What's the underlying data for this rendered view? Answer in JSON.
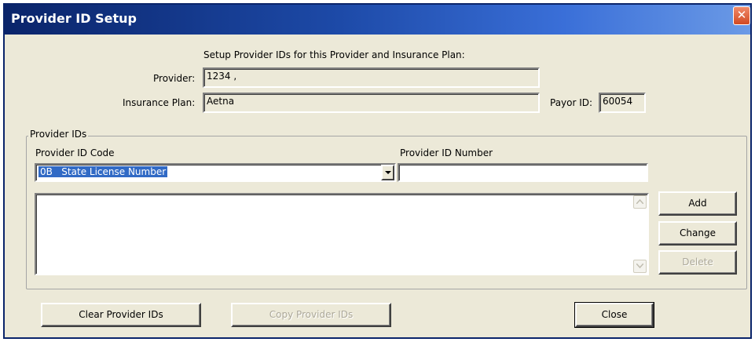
{
  "window": {
    "title": "Provider ID Setup"
  },
  "header": {
    "instruction": "Setup Provider IDs for this Provider and Insurance Plan:"
  },
  "provider": {
    "label": "Provider:",
    "value": "1234 ,"
  },
  "insurance_plan": {
    "label": "Insurance Plan:",
    "value": "Aetna"
  },
  "payor": {
    "label": "Payor ID:",
    "value": "60054"
  },
  "provider_ids_group": {
    "legend": "Provider IDs",
    "code_label": "Provider ID Code",
    "number_label": "Provider ID Number",
    "code_selected": "0B   State License Number",
    "number_value": "",
    "list_items": []
  },
  "buttons": {
    "add": "Add",
    "change": "Change",
    "delete": "Delete",
    "clear": "Clear Provider IDs",
    "copy": "Copy Provider IDs",
    "close": "Close"
  },
  "icons": {
    "close": "close-icon",
    "dropdown": "chevron-down-icon",
    "scroll_up": "scroll-up-icon",
    "scroll_down": "scroll-down-icon"
  }
}
